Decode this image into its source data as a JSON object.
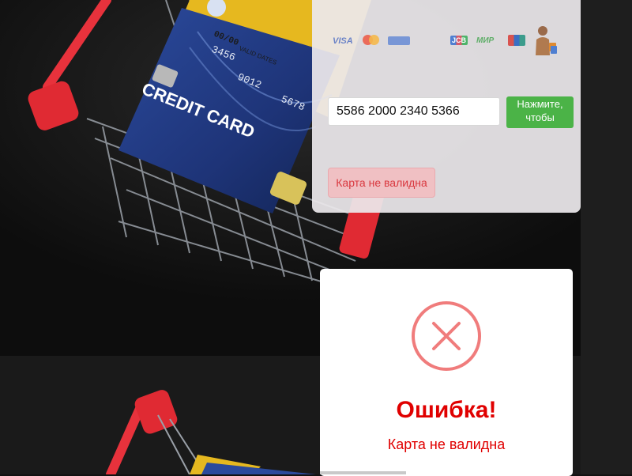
{
  "validator": {
    "payment_logos": [
      "visa-logo",
      "mastercard-logo",
      "amex-logo",
      "jcb-logo",
      "mir-logo",
      "unionpay-logo",
      "shopper-avatar"
    ],
    "visa_text": "VISA",
    "mir_text": "МИР",
    "card_input_value": "5586 2000 2340 5366",
    "check_button_label": "Нажмите, чтобы проверить",
    "result_text": "Карта не валидна"
  },
  "error_modal": {
    "icon": "error-circle-x-icon",
    "title": "Ошибка!",
    "message": "Карта не валидна",
    "timer_progress": 0.34
  },
  "background_card_text": {
    "credit_card": "CREDIT CARD",
    "valid_dates": "VALID DATES",
    "expiry": "00/00",
    "number_fragment": "3456",
    "number_group_1": "9012",
    "number_group_2": "5678"
  },
  "colors": {
    "accent_green": "#4bb347",
    "error_red": "#e00000",
    "badge_bg": "#f0c0c3"
  }
}
